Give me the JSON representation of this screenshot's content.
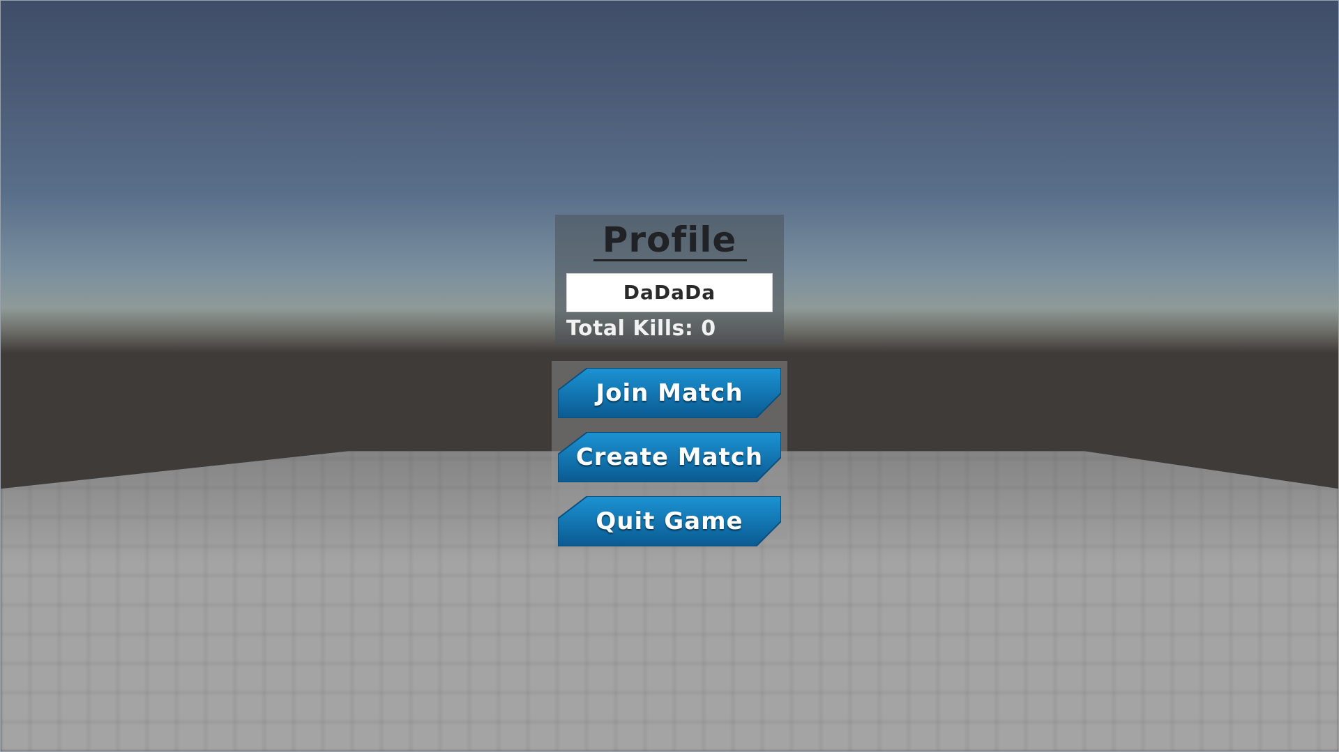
{
  "profile": {
    "title": "Profile",
    "username": "DaDaDa",
    "total_kills_label": "Total Kills: 0"
  },
  "menu": {
    "join_match": "Join Match",
    "create_match": "Create Match",
    "quit_game": "Quit Game"
  },
  "colors": {
    "button_fill_top": "#1a8fd0",
    "button_fill_bottom": "#0a5d94",
    "button_edge": "#0c4f7c",
    "panel_text": "#202225"
  }
}
